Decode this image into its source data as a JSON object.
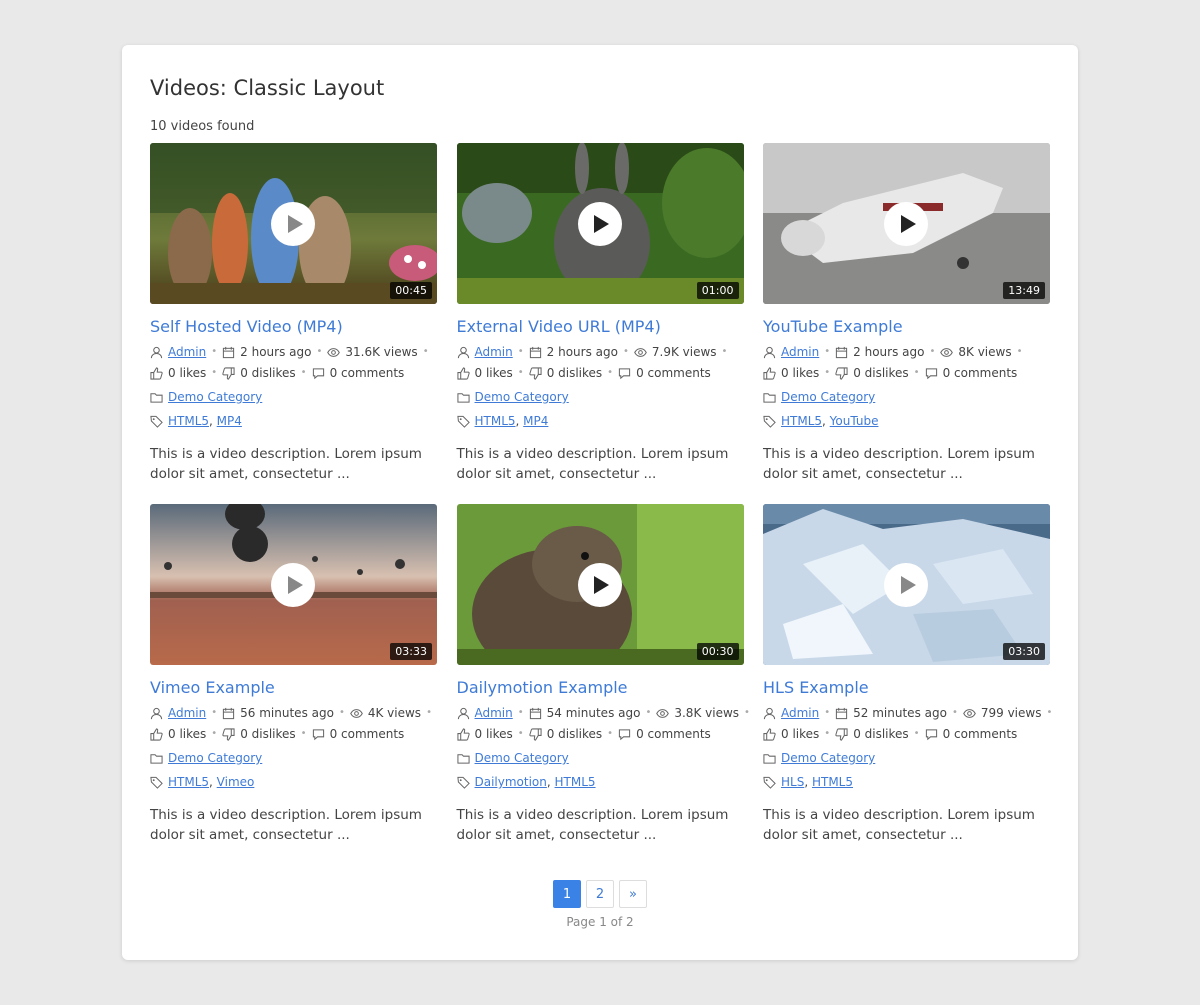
{
  "page": {
    "title": "Videos: Classic Layout",
    "count": "10 videos found"
  },
  "videos": [
    {
      "title": "Self Hosted Video (MP4)",
      "duration": "00:45",
      "author": "Admin",
      "date": "2 hours ago",
      "views": "31.6K views",
      "likes": "0 likes",
      "dislikes": "0 dislikes",
      "comments": "0 comments",
      "category": "Demo Category",
      "tag1": "HTML5",
      "tag2": "MP4",
      "description": "This is a video description. Lorem ipsum dolor sit amet, consectetur ..."
    },
    {
      "title": "External Video URL (MP4)",
      "duration": "01:00",
      "author": "Admin",
      "date": "2 hours ago",
      "views": "7.9K views",
      "likes": "0 likes",
      "dislikes": "0 dislikes",
      "comments": "0 comments",
      "category": "Demo Category",
      "tag1": "HTML5",
      "tag2": "MP4",
      "description": "This is a video description. Lorem ipsum dolor sit amet, consectetur ..."
    },
    {
      "title": "YouTube Example",
      "duration": "13:49",
      "author": "Admin",
      "date": "2 hours ago",
      "views": "8K views",
      "likes": "0 likes",
      "dislikes": "0 dislikes",
      "comments": "0 comments",
      "category": "Demo Category",
      "tag1": "HTML5",
      "tag2": "YouTube",
      "description": "This is a video description. Lorem ipsum dolor sit amet, consectetur ..."
    },
    {
      "title": "Vimeo Example",
      "duration": "03:33",
      "author": "Admin",
      "date": "56 minutes ago",
      "views": "4K views",
      "likes": "0 likes",
      "dislikes": "0 dislikes",
      "comments": "0 comments",
      "category": "Demo Category",
      "tag1": "HTML5",
      "tag2": "Vimeo",
      "description": "This is a video description. Lorem ipsum dolor sit amet, consectetur ..."
    },
    {
      "title": "Dailymotion Example",
      "duration": "00:30",
      "author": "Admin",
      "date": "54 minutes ago",
      "views": "3.8K views",
      "likes": "0 likes",
      "dislikes": "0 dislikes",
      "comments": "0 comments",
      "category": "Demo Category",
      "tag1": "Dailymotion",
      "tag2": "HTML5",
      "description": "This is a video description. Lorem ipsum dolor sit amet, consectetur ..."
    },
    {
      "title": "HLS Example",
      "duration": "03:30",
      "author": "Admin",
      "date": "52 minutes ago",
      "views": "799 views",
      "likes": "0 likes",
      "dislikes": "0 dislikes",
      "comments": "0 comments",
      "category": "Demo Category",
      "tag1": "HLS",
      "tag2": "HTML5",
      "description": "This is a video description. Lorem ipsum dolor sit amet, consectetur ..."
    }
  ],
  "pagination": {
    "pages": [
      "1",
      "2"
    ],
    "next": "»",
    "info": "Page 1 of 2"
  },
  "colors": {
    "link": "#3f7bd6",
    "active_page": "#3b82e6"
  }
}
